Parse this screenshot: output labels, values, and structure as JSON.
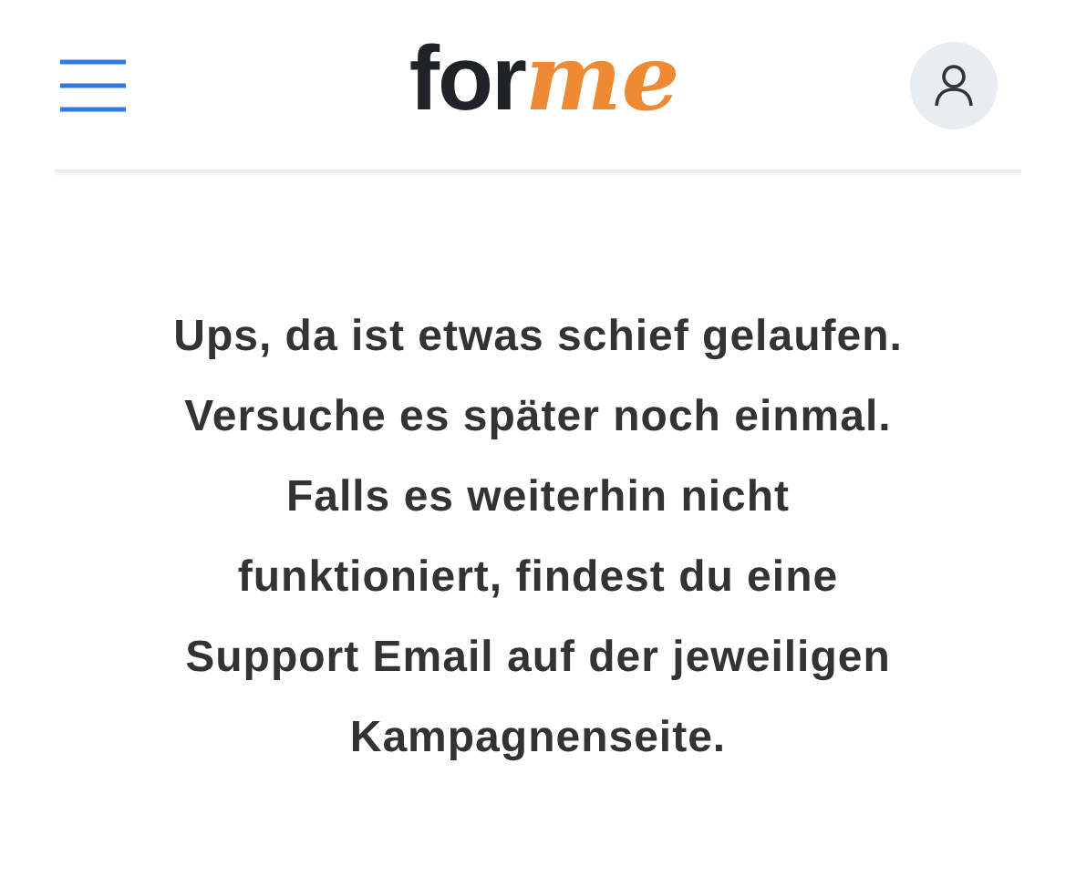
{
  "header": {
    "logo": {
      "parts": [
        "for",
        "me"
      ]
    }
  },
  "message": {
    "lines": [
      "Ups, da ist etwas schief gelaufen.",
      "Versuche es später noch einmal.",
      "Falls es weiterhin nicht",
      "funktioniert, findest du eine",
      "Support Email auf der jeweiligen",
      "Kampagnenseite."
    ]
  }
}
